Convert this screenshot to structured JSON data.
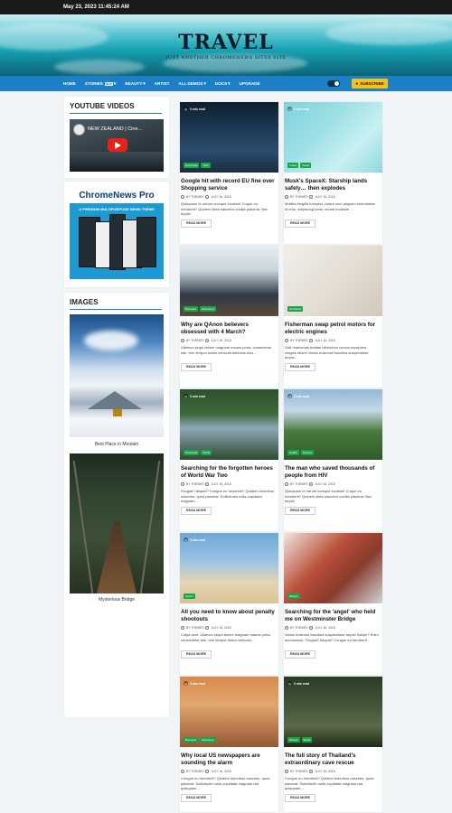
{
  "topbar": {
    "datetime": "May 23, 2023 11:45:24 AM"
  },
  "site": {
    "title": "TRAVEL",
    "tagline": "JUST ANOTHER CHROMENEWS SITES SITE"
  },
  "nav": {
    "items": [
      {
        "label": "HOME",
        "dropdown": false
      },
      {
        "label": "STORIES",
        "badge": "NEW",
        "dropdown": true
      },
      {
        "label": "BEAUTY",
        "dropdown": true
      },
      {
        "label": "ARTIST",
        "dropdown": false
      },
      {
        "label": "ALL DEMOS",
        "dropdown": true
      },
      {
        "label": "DOCS",
        "dropdown": true
      },
      {
        "label": "UPGRADE",
        "dropdown": false
      }
    ],
    "subscribe_label": "SUBSCRIBE",
    "toggle_icon": "dark-mode-toggle"
  },
  "sidebar": {
    "youtube": {
      "title": "YOUTUBE VIDEOS",
      "video_title": "NEW ZEALAND | Cine..."
    },
    "ad": {
      "title": "ChromeNews Pro",
      "subtitle": "A PREMIUM MULTIPURPOSE NEWS THEME"
    },
    "images": {
      "title": "IMAGES",
      "items": [
        {
          "caption": "Best Place in Moutain"
        },
        {
          "caption": "Mysterious Bridge"
        }
      ]
    }
  },
  "posts": [
    {
      "title": "Google hit with record EU fine over Shopping service",
      "read": "3 min read",
      "tags": [
        "Download",
        "Tech"
      ],
      "author": "BY THEMES",
      "date": "JULY 16, 2018",
      "excerpt": "Quisquam id rutrum cumque incidunt! Cuque eu hendrerit? Quidem dicta nascetur cubilia placerat. Nec turpis!",
      "more": "READ MORE"
    },
    {
      "title": "Musk's SpaceX: Starship lands safely… then explodes",
      "read": "3 min read",
      "tags": [
        "Travel",
        "World"
      ],
      "author": "BY THEMES",
      "date": "JULY 16, 2018",
      "excerpt": "Mollitia fringilla inceptos ornare cum aliquam exercitation id eros, adipiscing tortor ornare molestie…",
      "more": "READ MORE"
    },
    {
      "title": "Why are QAnon believers obsessed with 4 March?",
      "read": "",
      "tags": [
        "Business",
        "Download"
      ],
      "author": "BY THEMES",
      "date": "JULY 16, 2018",
      "excerpt": "Ullamco sequi facere magnam mauris porta, consectetur iste, rem tempor totam vehicula delectus eius…",
      "more": "READ MORE"
    },
    {
      "title": "Fisherman swap petrol motors for electric engines",
      "read": "",
      "tags": [
        "Download"
      ],
      "author": "BY THEMES",
      "date": "JULY 16, 2018",
      "excerpt": "Odit maecenas beatae bibendum cursus excepteur magnis etiam! Varius euismod faucibus suspendisse turpis!…",
      "more": "READ MORE"
    },
    {
      "title": "Searching for the forgotten heroes of World War Two",
      "read": "3 min read",
      "tags": [
        "Download",
        "World"
      ],
      "author": "BY THEMES",
      "date": "JULY 16, 2018",
      "excerpt": "Feugiat? Aliquid? Congue eu hendrerit? Quidem doloribus nascetur, quod placerat. Sollicitudin nulla cupidatat magnam…",
      "more": "READ MORE"
    },
    {
      "title": "The man who saved thousands of people from HIV",
      "read": "3 min read",
      "tags": [
        "Health",
        "Science"
      ],
      "author": "BY THEMES",
      "date": "JULY 16, 2018",
      "excerpt": "Quisquam id rutrum cumque incidunt! Cuque eu hendrerit? Quidem dicta nascetur cubilia placerat. Nec turpis!",
      "more": "READ MORE"
    },
    {
      "title": "All you need to know about penalty shootouts",
      "read": "3 min read",
      "tags": [
        "Sports"
      ],
      "author": "BY THEMES",
      "date": "JULY 16, 2018",
      "excerpt": "Culpa sem. Ullamco sequi facere magnam mauris porta, consectetur iste, rem tempor totam vehicula…",
      "more": "READ MORE"
    },
    {
      "title": "Searching for the 'angel' who held me on Westminster Bridge",
      "read": "",
      "tags": [
        "Movies"
      ],
      "author": "BY THEMES",
      "date": "JULY 16, 2018",
      "excerpt": "Varius euismod faucibus suspendisse turpis! Saepe? Enim accusamus. Feugiat? Aliquid? Congue eu hendrerit…",
      "more": "READ MORE"
    },
    {
      "title": "Why local US newspapers are sounding the alarm",
      "read": "3 min read",
      "tags": [
        "Business",
        "Download"
      ],
      "author": "BY THEMES",
      "date": "JULY 16, 2018",
      "excerpt": "Congue eu hendrerit? Quidem doloribus nascetur, quod placerat. Sollicitudin nulla cupidatat magnam nisi quisquam…",
      "more": "READ MORE"
    },
    {
      "title": "The full story of Thailand's extraordinary cave rescue",
      "read": "3 min read",
      "tags": [
        "Movies",
        "World"
      ],
      "author": "BY THEMES",
      "date": "JULY 16, 2018",
      "excerpt": "Congue eu hendrerit? Quidem doloribus nascetur, quod placerat. Sollicitudin nulla cupidatat magnam nisi quisquam…",
      "more": "READ MORE"
    }
  ],
  "colors": {
    "nav": "#1d7fc5",
    "subscribe": "#f3c119",
    "tag": "#1ca44a"
  }
}
